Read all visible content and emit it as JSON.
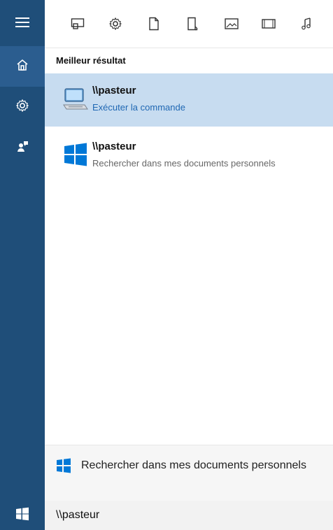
{
  "filters": {
    "icons": [
      "apps-icon",
      "settings-icon",
      "document-icon",
      "folder-icon",
      "photos-icon",
      "videos-icon",
      "music-icon"
    ]
  },
  "rail": {
    "items": [
      "hamburger-icon",
      "home-icon",
      "settings-icon",
      "feedback-icon"
    ]
  },
  "main": {
    "section_title": "Meilleur résultat",
    "results": [
      {
        "title": "\\\\pasteur",
        "subtitle": "Exécuter la commande"
      },
      {
        "title": "\\\\pasteur",
        "subtitle": "Rechercher dans mes documents personnels"
      }
    ]
  },
  "bottom": {
    "label": "Rechercher dans mes documents personnels"
  },
  "search": {
    "value": "\\\\pasteur"
  },
  "colors": {
    "rail": "#1f4e79",
    "selected_bg": "#c7dcf0",
    "accent_link": "#1f67b3",
    "windows_blue": "#0078d7"
  }
}
